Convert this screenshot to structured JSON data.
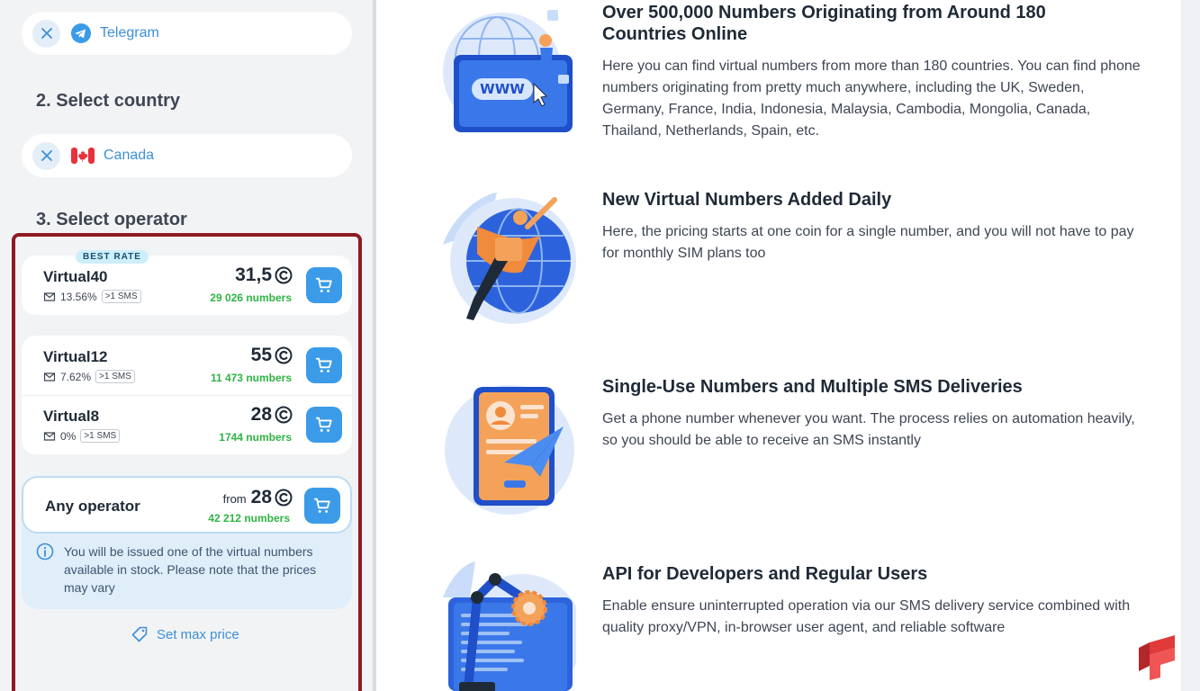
{
  "sidebar": {
    "service": {
      "label": "Telegram"
    },
    "step2": {
      "title": "2. Select country"
    },
    "country": {
      "label": "Canada"
    },
    "step3": {
      "title": "3. Select operator"
    },
    "best_rate_badge": "BEST RATE",
    "operators": [
      {
        "name": "Virtual40",
        "rate": "13.56%",
        "sms": ">1 SMS",
        "price": "31,5",
        "count": "29 026 numbers"
      },
      {
        "name": "Virtual12",
        "rate": "7.62%",
        "sms": ">1 SMS",
        "price": "55",
        "count": "11 473 numbers"
      },
      {
        "name": "Virtual8",
        "rate": "0%",
        "sms": ">1 SMS",
        "price": "28",
        "count": "1744 numbers"
      }
    ],
    "any_operator": {
      "name": "Any operator",
      "from": "from",
      "price": "28",
      "count": "42 212 numbers",
      "info": "You will be issued one of the virtual numbers available in stock. Please note that the prices may vary"
    },
    "max_price_label": "Set max price"
  },
  "features": [
    {
      "title": "Over 500,000 Numbers Originating from Around 180 Countries Online",
      "text": "Here you can find virtual numbers from more than 180 countries. You can find phone numbers originating from pretty much anywhere, including the UK, Sweden, Germany, France, India, Indonesia, Malaysia, Cambodia, Mongolia, Canada, Thailand, Netherlands, Spain, etc.",
      "illustration_text": "WWW"
    },
    {
      "title": "New Virtual Numbers Added Daily",
      "text": "Here, the pricing starts at one coin for a single number, and you will not have to pay for monthly SIM plans too"
    },
    {
      "title": "Single-Use Numbers and Multiple SMS Deliveries",
      "text": "Get a phone number whenever you want. The process relies on automation heavily, so you should be able to receive an SMS instantly"
    },
    {
      "title": "API for Developers and Regular Users",
      "text": "Enable ensure uninterrupted operation via our SMS delivery service combined with quality proxy/VPN, in-browser user agent, and reliable software"
    }
  ],
  "colors": {
    "accent": "#3b9be8",
    "link": "#3d8fd6",
    "success": "#2fb344",
    "highlight_border": "#8e1b21"
  }
}
